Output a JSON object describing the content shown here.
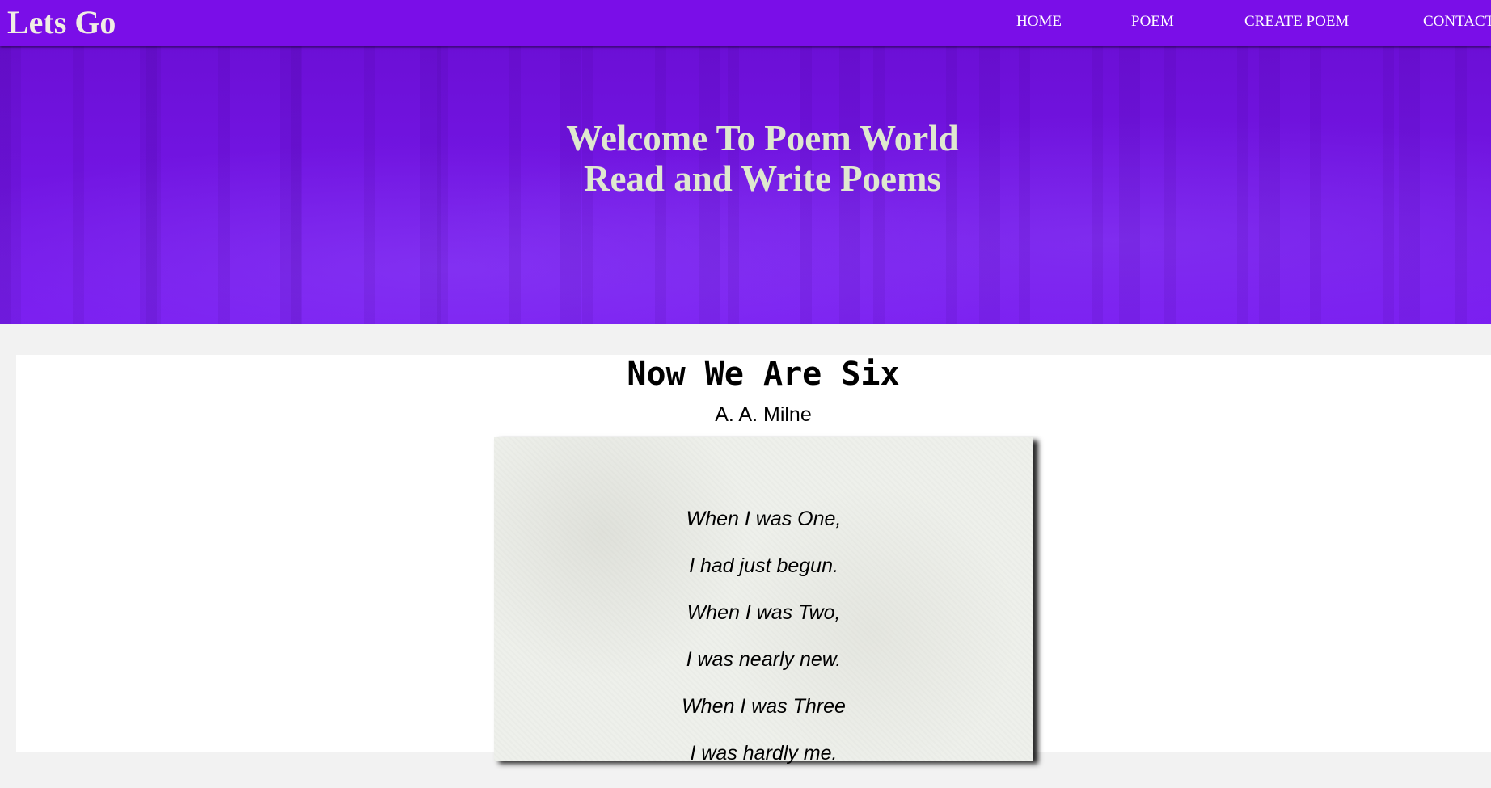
{
  "navbar": {
    "logo": "Lets Go",
    "links": [
      "HOME",
      "POEM",
      "CREATE POEM",
      "CONTACT"
    ]
  },
  "hero": {
    "title_line1": "Welcome To Poem World",
    "title_line2": "Read and Write Poems"
  },
  "poem": {
    "title": "Now We Are Six",
    "author": "A. A. Milne",
    "lines": [
      "When I was One,",
      "I had just begun.",
      "When I was Two,",
      "I was nearly new.",
      "When I was Three",
      "I was hardly me."
    ]
  },
  "colors": {
    "navbar": "#7a0ee8",
    "hero": "#7417e6",
    "hero_text": "#dfe8cf",
    "page_background": "#f2f2f2"
  }
}
